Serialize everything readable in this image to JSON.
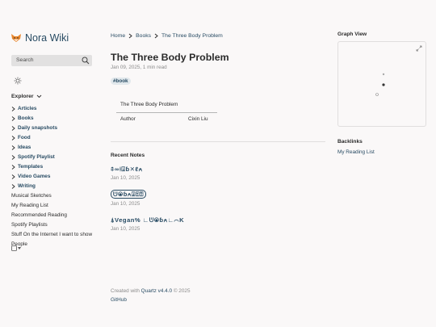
{
  "site": {
    "title": "Nora Wiki",
    "logo_icon": "fox-icon"
  },
  "search": {
    "label": "Search"
  },
  "explorer": {
    "title": "Explorer",
    "folders": [
      "Articles",
      "Books",
      "Daily snapshots",
      "Food",
      "Ideas",
      "Spotify Playlist",
      "Templates",
      "Video Games",
      "Writing"
    ],
    "files": [
      "Musical Sketches",
      "My Reading List",
      "Recommended Reading",
      "Spotify Playlists",
      "Stuff On the Internet I want to show",
      "People"
    ]
  },
  "breadcrumb": {
    "home": "Home",
    "books": "Books",
    "current": "The Three Body Problem"
  },
  "page": {
    "title": "The Three Body Problem",
    "meta": "Jan 09, 2025, 1 min read",
    "tag": "#book",
    "table": {
      "header": "The Three Body Problem",
      "key": "Author",
      "value": "Cixin Liu"
    }
  },
  "recent": {
    "title": "Recent Notes",
    "notes": [
      {
        "label": "⍏∞⍿⍗ɓ✕ℓ⍲",
        "date": "Jan 10, 2025"
      },
      {
        "label": "ᕫ⦿ɓ⍲⍗⍐⍰",
        "date": "Jan 10, 2025"
      },
      {
        "label": "⍋Vegan% ∟ᕫ⦿ɓ⍲∟⌒K",
        "date": "Jan 10, 2025"
      }
    ]
  },
  "footer": {
    "created": "Created with",
    "quartz": "Quartz v4.4.0",
    "year": "© 2025",
    "github": "GitHub"
  },
  "graph": {
    "title": "Graph View"
  },
  "backlinks": {
    "title": "Backlinks",
    "link": "My Reading List"
  },
  "colors": {
    "accent": "#284b63",
    "background": "#faf8f8",
    "text": "#2b2b2b",
    "muted": "#8b8b8b"
  }
}
